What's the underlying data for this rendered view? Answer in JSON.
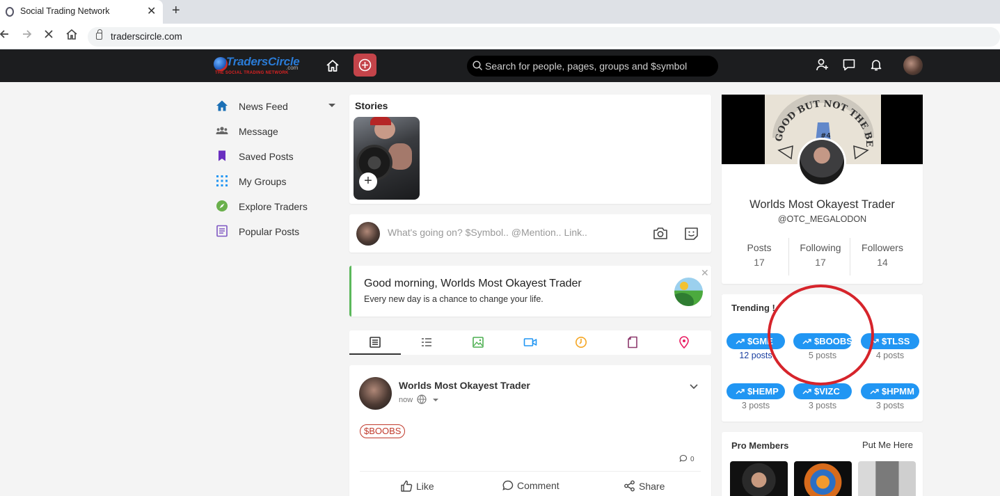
{
  "browser": {
    "tab_title": "Social Trading Network",
    "url": "traderscircle.com"
  },
  "header": {
    "logo_text": "TradersCircle",
    "logo_com": ".com",
    "logo_tagline": "THE SOCIAL TRADING NETWORK",
    "search_placeholder": "Search for people, pages, groups and $symbol"
  },
  "sidebar": {
    "items": [
      {
        "label": "News Feed",
        "icon": "home-icon",
        "color": "#1a6fb5"
      },
      {
        "label": "Message",
        "icon": "users-icon",
        "color": "#666666"
      },
      {
        "label": "Saved Posts",
        "icon": "bookmark-icon",
        "color": "#6a2fc0"
      },
      {
        "label": "My Groups",
        "icon": "groups-icon",
        "color": "#2196f3"
      },
      {
        "label": "Explore Traders",
        "icon": "compass-icon",
        "color": "#6ab04c"
      },
      {
        "label": "Popular Posts",
        "icon": "document-icon",
        "color": "#7e57c2"
      }
    ]
  },
  "stories": {
    "title": "Stories"
  },
  "composer": {
    "placeholder": "What's going on? $Symbol.. @Mention.. Link.."
  },
  "greeting": {
    "title": "Good morning, Worlds Most Okayest Trader",
    "subtitle": "Every new day is a chance to change your life."
  },
  "post": {
    "author": "Worlds Most Okayest Trader",
    "time": "now",
    "tag": "$BOOBS",
    "comment_count": "0",
    "actions": {
      "like": "Like",
      "comment": "Comment",
      "share": "Share"
    }
  },
  "profile": {
    "name": "Worlds Most Okayest Trader",
    "handle": "@OTC_MEGALODON",
    "stats": [
      {
        "label": "Posts",
        "value": "17"
      },
      {
        "label": "Following",
        "value": "17"
      },
      {
        "label": "Followers",
        "value": "14"
      }
    ]
  },
  "trending": {
    "title": "Trending !",
    "items": [
      {
        "symbol": "$GME",
        "count": "12 posts"
      },
      {
        "symbol": "$BOOBS",
        "count": "5 posts"
      },
      {
        "symbol": "$TLSS",
        "count": "4 posts"
      },
      {
        "symbol": "$HEMP",
        "count": "3 posts"
      },
      {
        "symbol": "$VIZC",
        "count": "3 posts"
      },
      {
        "symbol": "$HPMM",
        "count": "3 posts"
      }
    ]
  },
  "pro_members": {
    "title": "Pro Members",
    "link": "Put Me Here"
  },
  "colors": {
    "header_bg": "#1c1d1f",
    "accent_plus": "#c4444a",
    "chip": "#2196f3",
    "annotation": "#d6242b",
    "tag": "#c0392b"
  }
}
